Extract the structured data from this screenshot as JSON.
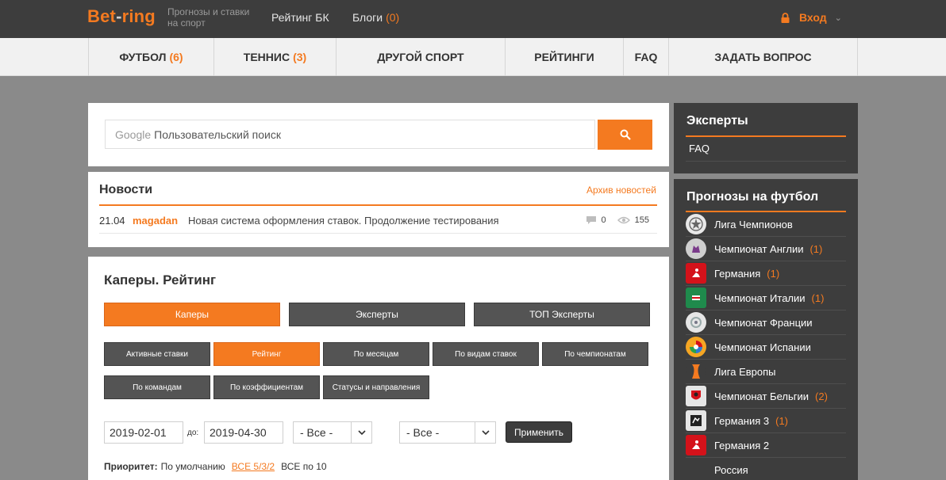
{
  "header": {
    "logo_main": "Bet",
    "logo_dash": "-",
    "logo_tail": "ring",
    "tagline_1": "Прогнозы и ставки",
    "tagline_2": "на спорт",
    "links": [
      {
        "label": "Рейтинг БК",
        "count": ""
      },
      {
        "label": "Блоги",
        "count": "(0)"
      }
    ],
    "login_label": "Вход"
  },
  "nav": [
    {
      "label": "Футбол",
      "count": "(6)"
    },
    {
      "label": "Теннис",
      "count": "(3)"
    },
    {
      "label": "Другой спорт",
      "count": ""
    },
    {
      "label": "Рейтинги",
      "count": ""
    },
    {
      "label": "FAQ",
      "count": ""
    },
    {
      "label": "Задать вопрос",
      "count": ""
    }
  ],
  "search": {
    "google_label": "Google",
    "placeholder": "Пользовательский поиск"
  },
  "news": {
    "title": "Новости",
    "archive_link": "Архив новостей",
    "items": [
      {
        "date": "21.04",
        "author": "magadan",
        "text": "Новая система оформления ставок. Продолжение тестирования",
        "comments": "0",
        "views": "155"
      }
    ]
  },
  "rating": {
    "title": "Каперы. Рейтинг",
    "main_tabs": [
      "Каперы",
      "Эксперты",
      "ТОП Эксперты"
    ],
    "sub_tabs": [
      "Активные ставки",
      "Рейтинг",
      "По месяцам",
      "По видам ставок",
      "По чемпионатам",
      "По командам",
      "По коэффициентам",
      "Статусы и направления"
    ],
    "date_from": "2019-02-01",
    "date_sep": "до:",
    "date_to": "2019-04-30",
    "select_1": "- Все -",
    "select_2": "- Все -",
    "apply_label": "Применить",
    "priority_label": "Приоритет:",
    "priority_default": "По умолчанию",
    "priority_link": "ВСЕ 5/3/2",
    "priority_all10": "ВСЕ по 10"
  },
  "sidebar": {
    "experts_title": "Эксперты",
    "experts_link": "FAQ",
    "football_title": "Прогнозы на футбол",
    "leagues": [
      {
        "name": "Лига Чемпионов",
        "count": "",
        "icon": "champions-league-icon"
      },
      {
        "name": "Чемпионат Англии",
        "count": "(1)",
        "icon": "premier-league-icon"
      },
      {
        "name": "Германия",
        "count": "(1)",
        "icon": "bundesliga-icon"
      },
      {
        "name": "Чемпионат Италии",
        "count": "(1)",
        "icon": "serie-a-icon"
      },
      {
        "name": "Чемпионат Франции",
        "count": "",
        "icon": "ligue-1-icon"
      },
      {
        "name": "Чемпионат Испании",
        "count": "",
        "icon": "la-liga-icon"
      },
      {
        "name": "Лига Европы",
        "count": "",
        "icon": "europa-league-icon"
      },
      {
        "name": "Чемпионат Бельгии",
        "count": "(2)",
        "icon": "belgium-league-icon"
      },
      {
        "name": "Германия 3",
        "count": "(1)",
        "icon": "liga-3-icon"
      },
      {
        "name": "Германия 2",
        "count": "",
        "icon": "bundesliga-2-icon"
      },
      {
        "name": "Россия",
        "count": "",
        "icon": "russia-league-icon"
      }
    ]
  },
  "colors": {
    "accent": "#f47a20",
    "dark": "#3d3d3d"
  }
}
